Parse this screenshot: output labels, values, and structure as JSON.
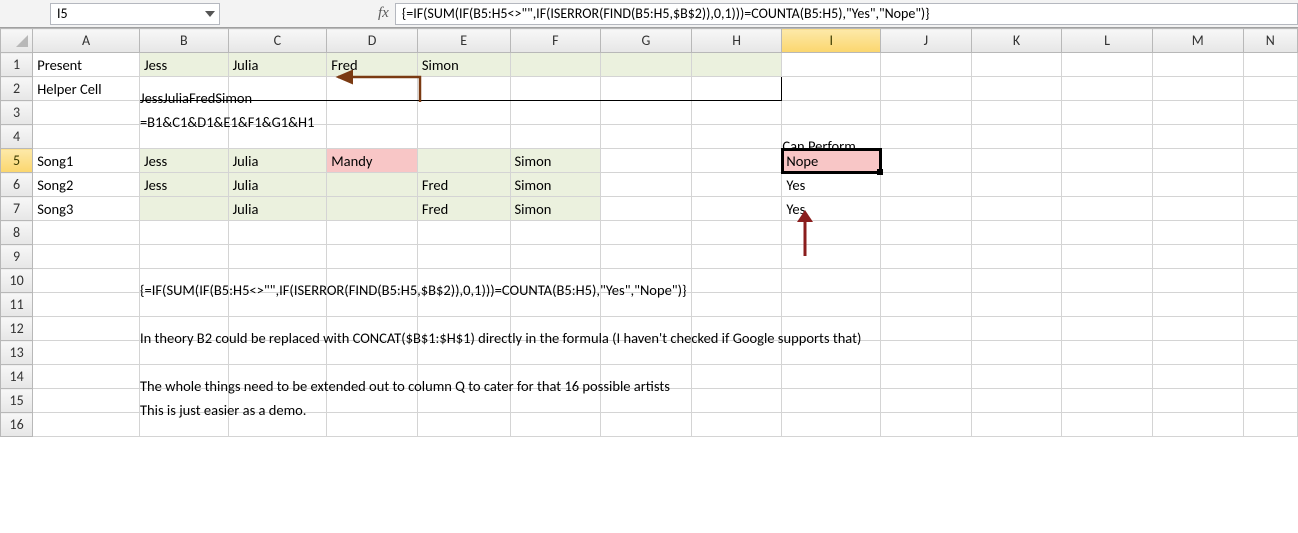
{
  "name_box": "I5",
  "fx_label": "fx",
  "formula_bar": "{=IF(SUM(IF(B5:H5<>\"\",IF(ISERROR(FIND(B5:H5,$B$2)),0,1)))=COUNTA(B5:H5),\"Yes\",\"Nope\")}",
  "columns": [
    "A",
    "B",
    "C",
    "D",
    "E",
    "F",
    "G",
    "H",
    "I",
    "J",
    "K",
    "L",
    "M",
    "N"
  ],
  "rows": [
    "1",
    "2",
    "3",
    "4",
    "5",
    "6",
    "7",
    "8",
    "9",
    "10",
    "11",
    "12",
    "13",
    "14",
    "15",
    "16"
  ],
  "cells": {
    "A1": "Present",
    "B1": "Jess",
    "C1": "Julia",
    "D1": "Fred",
    "E1": "Simon",
    "A2": "Helper Cell",
    "B2": "JessJuliaFredSimon",
    "B3": "=B1&C1&D1&E1&F1&G1&H1",
    "I4": "Can Perform",
    "A5": "Song1",
    "B5": "Jess",
    "C5": "Julia",
    "D5": "Mandy",
    "F5": "Simon",
    "I5": "Nope",
    "A6": "Song2",
    "B6": "Jess",
    "C6": "Julia",
    "E6": "Fred",
    "F6": "Simon",
    "I6": "Yes",
    "A7": "Song3",
    "C7": "Julia",
    "E7": "Fred",
    "F7": "Simon",
    "I7": "Yes",
    "B10": "{=IF(SUM(IF(B5:H5<>\"\",IF(ISERROR(FIND(B5:H5,$B$2)),0,1)))=COUNTA(B5:H5),\"Yes\",\"Nope\")}",
    "B12": "In theory B2 could be replaced with CONCAT($B$1:$H$1) directly in the formula (I haven't checked if Google supports that)",
    "B14": "The whole things need to be extended out to column Q to cater for that 16 possible artists",
    "B15": "This is just easier as a demo."
  },
  "active_col": "I",
  "active_row": "5"
}
